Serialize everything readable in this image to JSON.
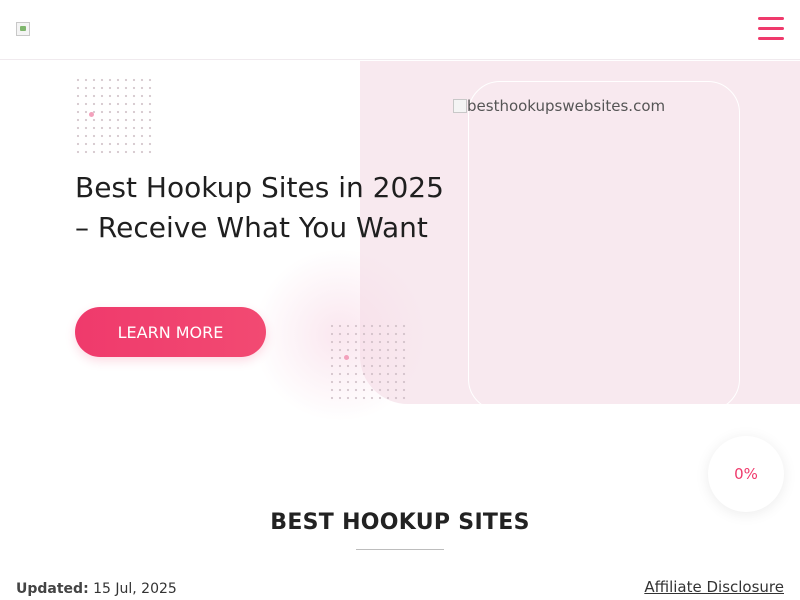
{
  "header": {
    "logo_icon": "broken-image-icon",
    "menu_icon": "hamburger-icon",
    "accent_color": "#ef3a6c"
  },
  "hero": {
    "title": "Best Hookup Sites in 2025 – Receive What You Want",
    "cta_label": "LEARN MORE",
    "image_alt": "besthookupswebsites.com",
    "bg_color": "#f8e9ef"
  },
  "progress": {
    "label": "0%"
  },
  "section": {
    "title": "BEST HOOKUP SITES",
    "updated_label": "Updated:",
    "updated_date": "15 Jul, 2025",
    "disclosure_link": "Affiliate Disclosure"
  }
}
